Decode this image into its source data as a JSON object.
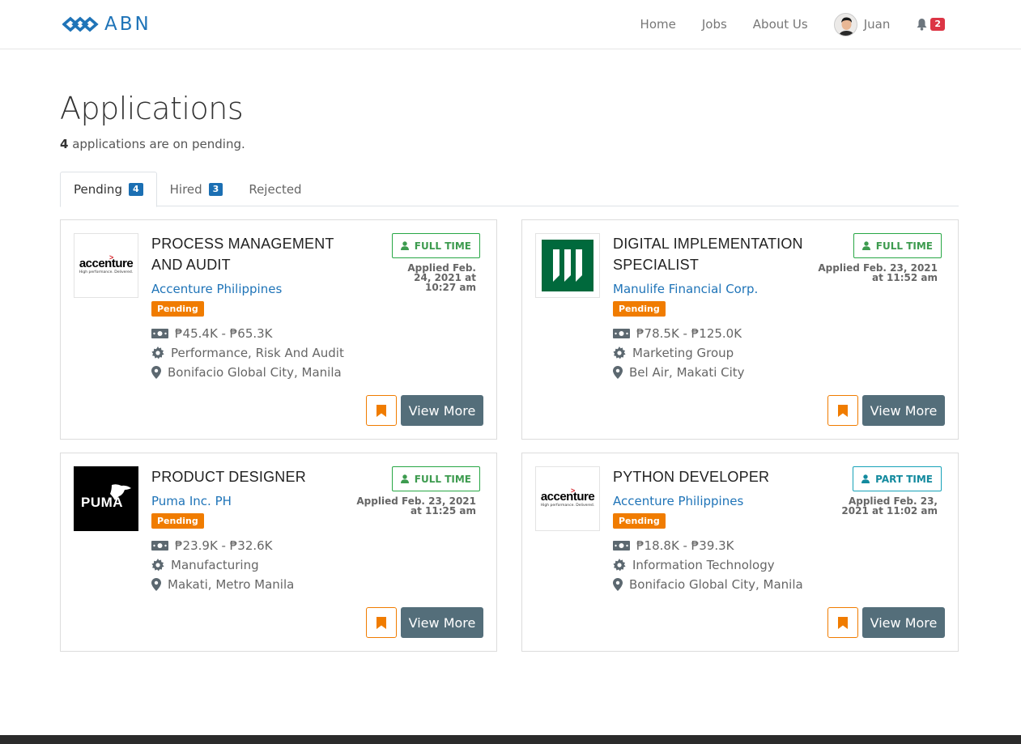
{
  "navbar": {
    "brand": "ABN",
    "links": [
      "Home",
      "Jobs",
      "About Us"
    ],
    "user_name": "Juan",
    "notification_count": "2"
  },
  "header": {
    "title": "Applications",
    "sub_count": "4",
    "sub_text": " applications are on pending."
  },
  "tabs": [
    {
      "label": "Pending",
      "count": "4"
    },
    {
      "label": "Hired",
      "count": "3"
    },
    {
      "label": "Rejected",
      "count": ""
    }
  ],
  "colors": {
    "brand": "#1f74b8",
    "pending": "#f07c00",
    "full_time": "#28a745",
    "part_time": "#17a2b8",
    "view_button": "#546e7a",
    "notification": "#dc3545"
  },
  "cards": [
    {
      "logo": "accenture-logo",
      "title": "PROCESS MANAGEMENT AND AUDIT",
      "company": "Accenture Philippines",
      "status": "Pending",
      "type": "FULL TIME",
      "applied": "Applied Feb. 24, 2021 at 10:27 am",
      "salary": "₱45.4K - ₱65.3K",
      "category": "Performance, Risk And Audit",
      "location": "Bonifacio Global City, Manila",
      "view_label": "View More"
    },
    {
      "logo": "manulife-logo",
      "title": "DIGITAL IMPLEMENTATION SPECIALIST",
      "company": "Manulife Financial Corp.",
      "status": "Pending",
      "type": "FULL TIME",
      "applied": "Applied Feb. 23, 2021 at 11:52 am",
      "salary": "₱78.5K - ₱125.0K",
      "category": "Marketing Group",
      "location": "Bel Air, Makati City",
      "view_label": "View More"
    },
    {
      "logo": "puma-logo",
      "title": "PRODUCT DESIGNER",
      "company": "Puma Inc. PH",
      "status": "Pending",
      "type": "FULL TIME",
      "applied": "Applied Feb. 23, 2021 at 11:25 am",
      "salary": "₱23.9K - ₱32.6K",
      "category": "Manufacturing",
      "location": "Makati, Metro Manila",
      "view_label": "View More"
    },
    {
      "logo": "accenture-logo",
      "title": "PYTHON DEVELOPER",
      "company": "Accenture Philippines",
      "status": "Pending",
      "type": "PART TIME",
      "applied": "Applied Feb. 23, 2021 at 11:02 am",
      "salary": "₱18.8K - ₱39.3K",
      "category": "Information Technology",
      "location": "Bonifacio Global City, Manila",
      "view_label": "View More"
    }
  ],
  "logo_text": {
    "accenture_word": "accenture",
    "accenture_tagline": "High performance. Delivered.",
    "puma_word": "PUMA"
  }
}
